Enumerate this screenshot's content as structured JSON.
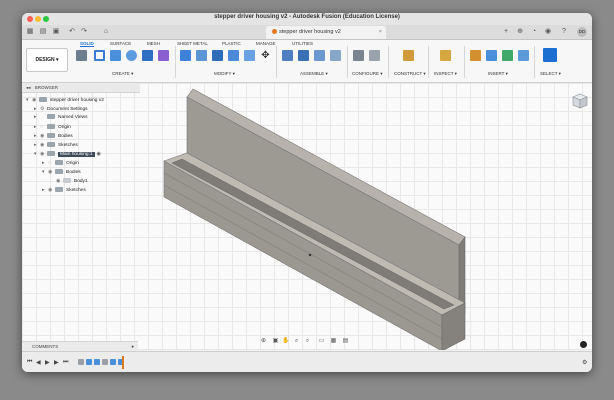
{
  "window": {
    "title": "stepper driver housing v2 - Autodesk Fusion (Education License)"
  },
  "doc_tab": {
    "label": "stepper driver housing v2",
    "close": "×"
  },
  "user": {
    "initials": "DD"
  },
  "toolbar": {
    "workspace": "DESIGN ▾",
    "tabs": [
      "SOLID",
      "SURFACE",
      "MESH",
      "SHEET METAL",
      "PLASTIC",
      "MANAGE",
      "UTILITIES"
    ],
    "groups": [
      "CREATE ▾",
      "MODIFY ▾",
      "ASSEMBLE ▾",
      "CONFIGURE ▾",
      "CONSTRUCT ▾",
      "INSPECT ▾",
      "INSERT ▾",
      "SELECT ▾"
    ]
  },
  "browser": {
    "title": "BROWSER",
    "items": [
      {
        "label": "stepper driver housing v2",
        "indent": 0
      },
      {
        "label": "Document Settings",
        "indent": 1
      },
      {
        "label": "Named Views",
        "indent": 1
      },
      {
        "label": "Origin",
        "indent": 1
      },
      {
        "label": "Bodies",
        "indent": 1
      },
      {
        "label": "Sketches",
        "indent": 1
      },
      {
        "label": "Main housing:1",
        "indent": 1,
        "selected": true
      },
      {
        "label": "Origin",
        "indent": 2
      },
      {
        "label": "Bodies",
        "indent": 2
      },
      {
        "label": "Body1",
        "indent": 3
      },
      {
        "label": "Sketches",
        "indent": 2
      }
    ]
  },
  "comments": {
    "title": "COMMENTS"
  },
  "colors": {
    "accent": "#1a6fd1",
    "model_face": "#9c9993",
    "model_top": "#b5b1aa"
  }
}
